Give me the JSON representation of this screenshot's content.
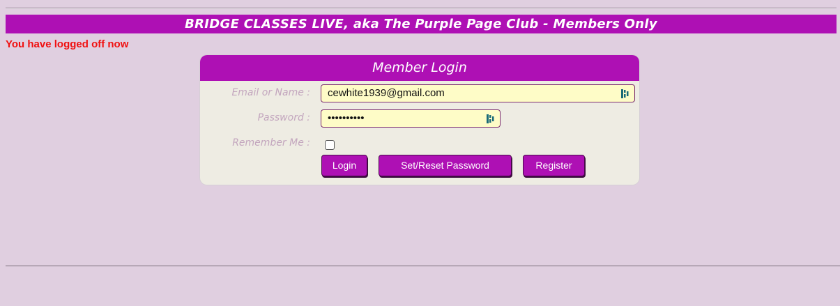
{
  "header": {
    "title": "BRIDGE CLASSES LIVE, aka The Purple Page Club - Members Only"
  },
  "status": {
    "message": "You have logged off now"
  },
  "login": {
    "title": "Member Login",
    "email_label": "Email or Name :",
    "email_value": "cewhite1939@gmail.com",
    "password_label": "Password :",
    "password_value": "••••••••••",
    "remember_label": "Remember Me :",
    "remember_checked": false,
    "login_button": "Login",
    "reset_button": "Set/Reset Password",
    "register_button": "Register",
    "password_manager_icon": "password-manager-icon"
  },
  "colors": {
    "brand_purple": "#ae10b4",
    "background": "#e0cfe0",
    "panel": "#eeece3",
    "field_bg": "#fefcc7",
    "error_red": "#f01010",
    "label_color": "#c3a6be"
  }
}
